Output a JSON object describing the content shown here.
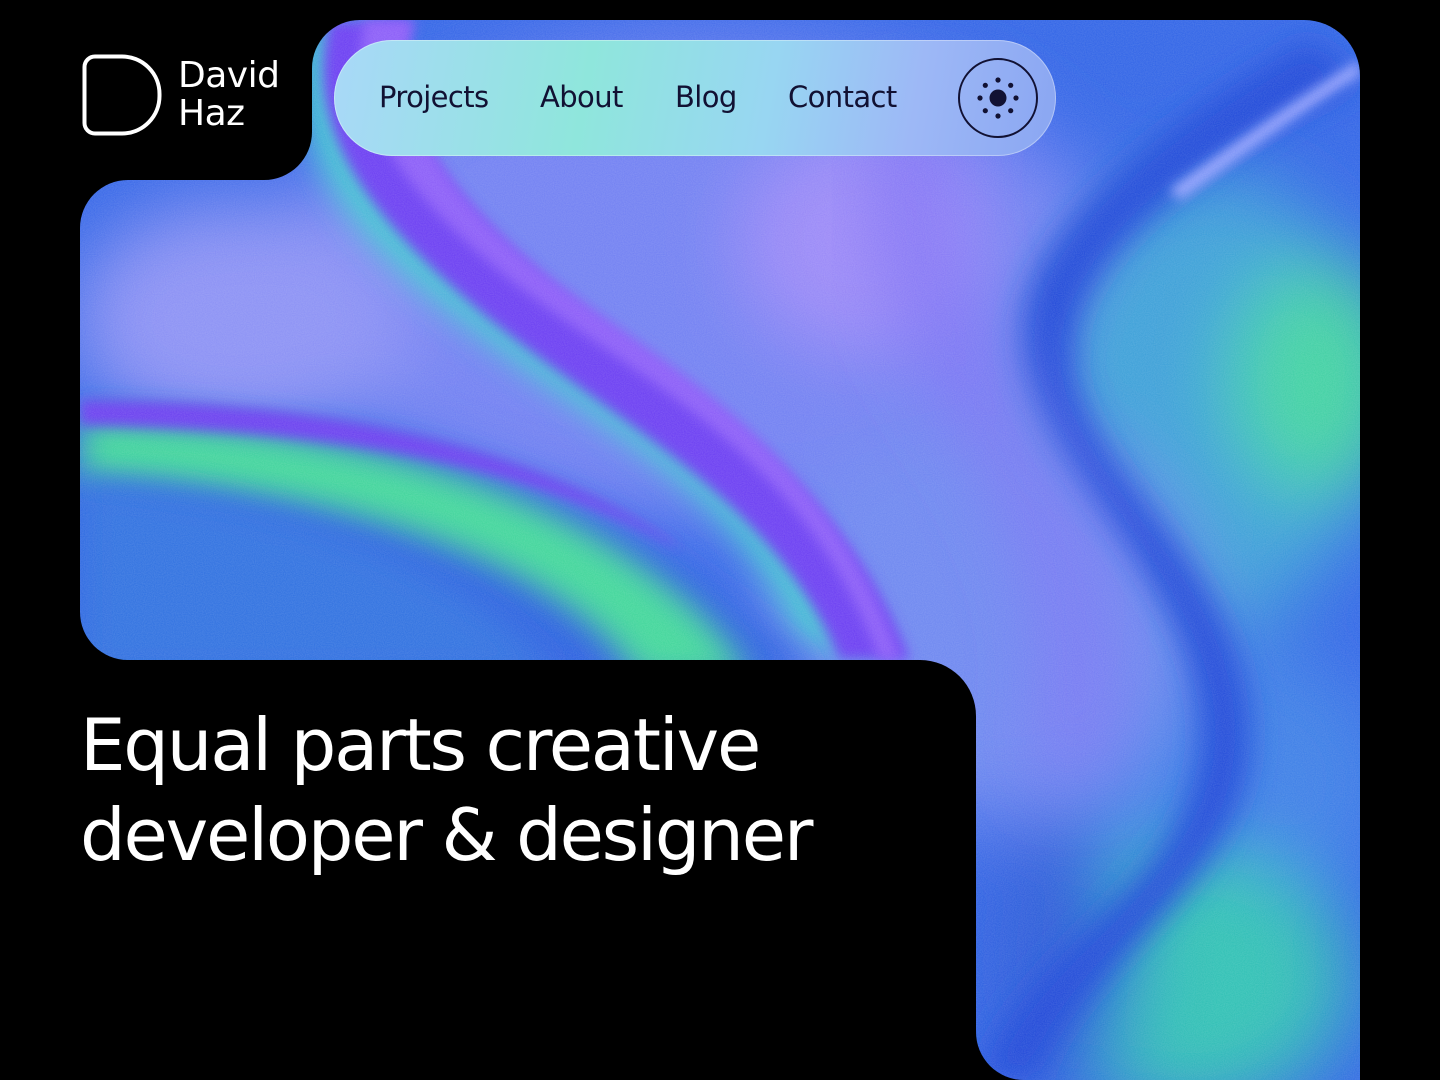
{
  "brand": {
    "first_name": "David",
    "last_name": "Haz",
    "logo_icon": "rounded-d-logo-icon"
  },
  "nav": {
    "items": [
      {
        "label": "Projects"
      },
      {
        "label": "About"
      },
      {
        "label": "Blog"
      },
      {
        "label": "Contact"
      }
    ],
    "theme_toggle_icon": "sun-icon"
  },
  "hero": {
    "headline_line1": "Equal parts creative",
    "headline_line2": "developer & designer"
  },
  "colors": {
    "background": "#000000",
    "text_primary": "#ffffff",
    "nav_text": "#111133",
    "gradient_blue": "#2f5fe0",
    "gradient_violet": "#7a5cf5",
    "gradient_green": "#3fd6a0"
  }
}
